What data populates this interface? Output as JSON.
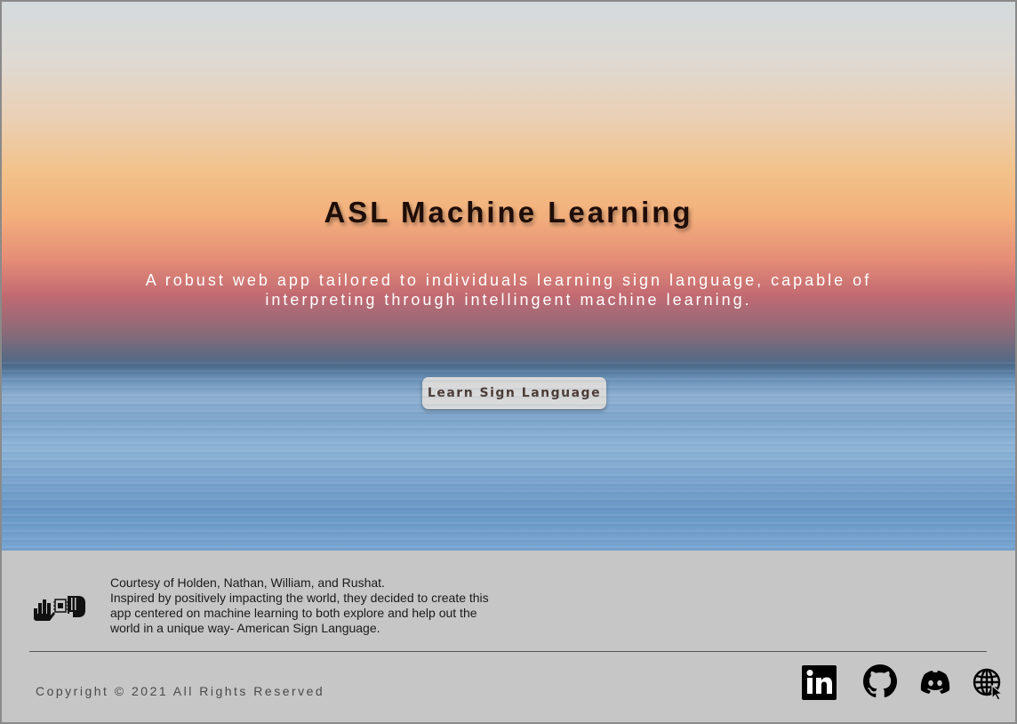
{
  "hero": {
    "title": "ASL Machine Learning",
    "subtitle": "A robust web app tailored to individuals learning sign language, capable of interpreting through intellingent machine learning.",
    "cta_label": "Learn Sign Language"
  },
  "footer": {
    "about_lines": [
      "Courtesy of Holden, Nathan, William, and Rushat.",
      "Inspired by positively impacting the world, they decided to create this",
      "app centered on machine learning to both explore and help out the",
      "world in a unique way- American Sign Language."
    ],
    "copyright": "Copyright © 2021 All Rights Reserved",
    "social_icons": [
      "linkedin-icon",
      "github-icon",
      "discord-icon",
      "globe-icon"
    ]
  },
  "colors": {
    "title": "#1e0d08",
    "footer_bg": "#c6c6c6",
    "button_bg": "#d9d9d9"
  }
}
